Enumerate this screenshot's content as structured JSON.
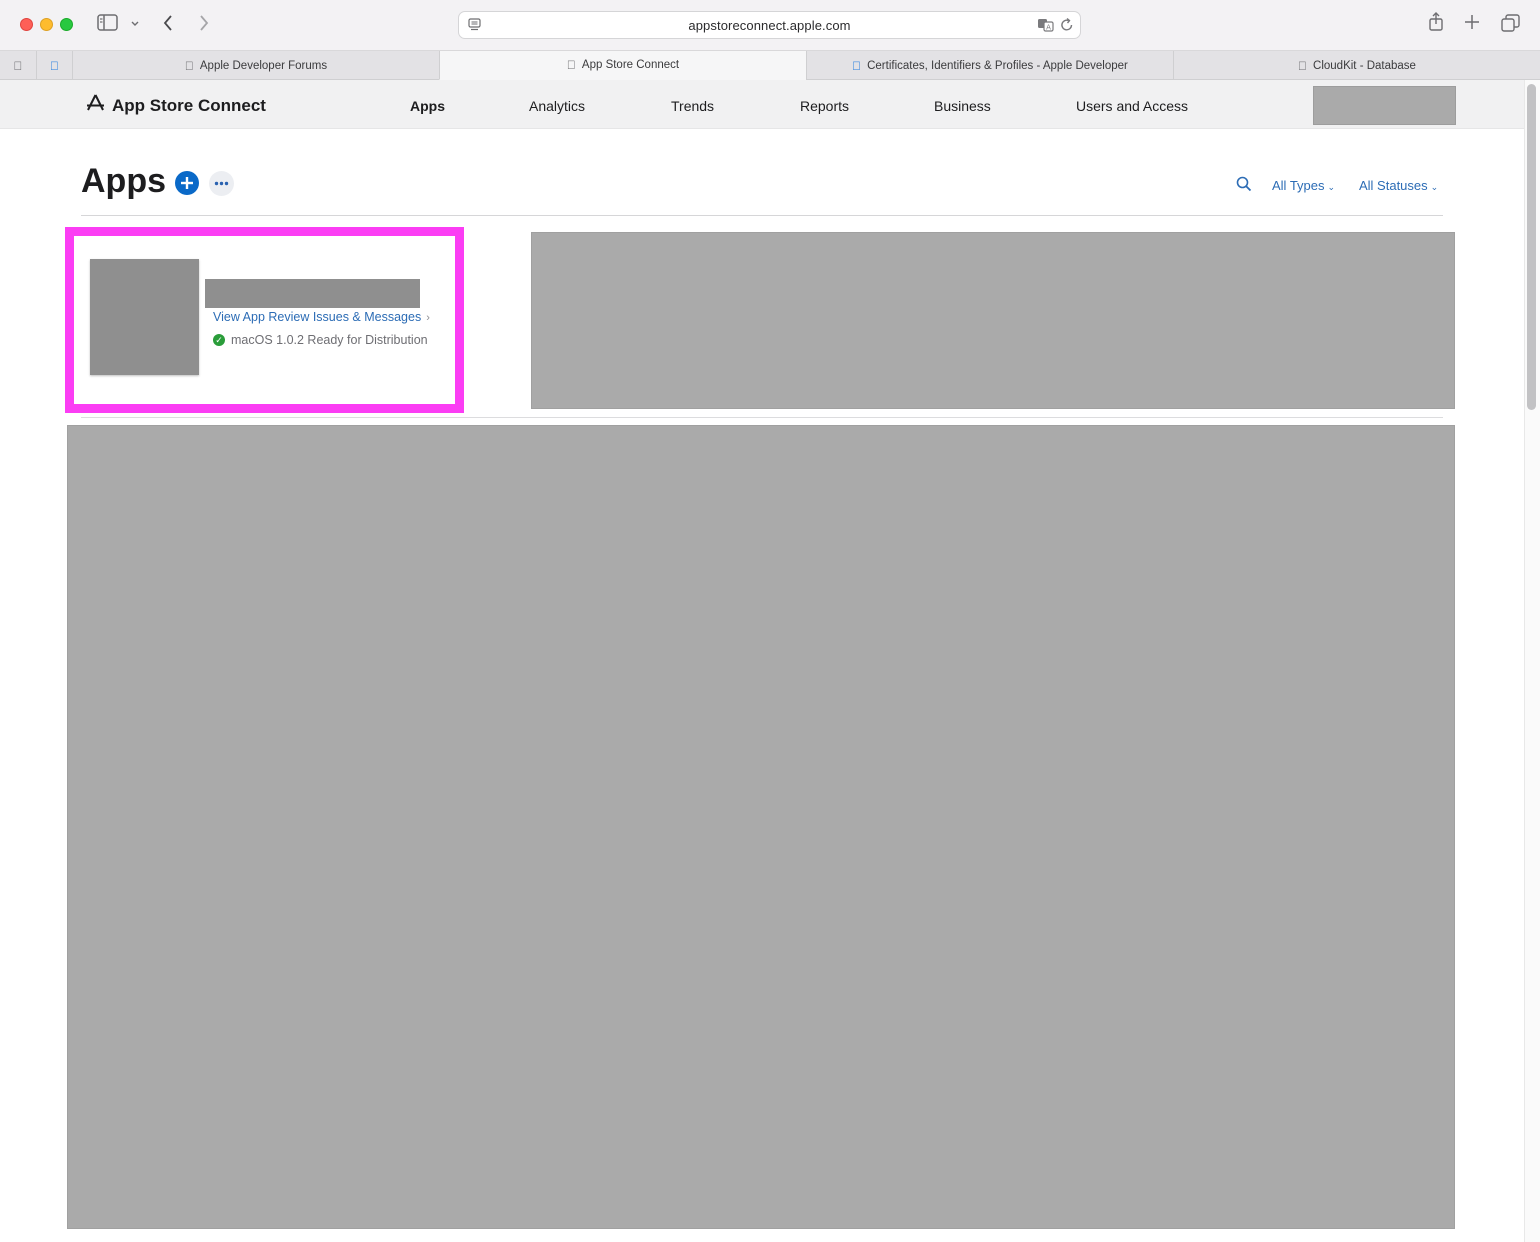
{
  "browser": {
    "url": "appstoreconnect.apple.com",
    "tabs": [
      {
        "label": "Apple Developer Forums"
      },
      {
        "label": "App Store Connect"
      },
      {
        "label": "Certificates, Identifiers & Profiles - Apple Developer"
      },
      {
        "label": "CloudKit - Database"
      }
    ]
  },
  "header": {
    "brand": "App Store Connect",
    "nav": [
      "Apps",
      "Analytics",
      "Trends",
      "Reports",
      "Business",
      "Users and Access"
    ]
  },
  "page": {
    "title": "Apps",
    "filters": {
      "types": "All Types",
      "statuses": "All Statuses"
    }
  },
  "app_card": {
    "review_link": "View App Review Issues & Messages",
    "status": "macOS 1.0.2 Ready for Distribution"
  },
  "colors": {
    "accent": "#0a69c8",
    "link": "#2c6cb5",
    "highlight": "#fb3df4",
    "status_ok": "#2a9d3a",
    "redaction": "#aaaaaa"
  }
}
